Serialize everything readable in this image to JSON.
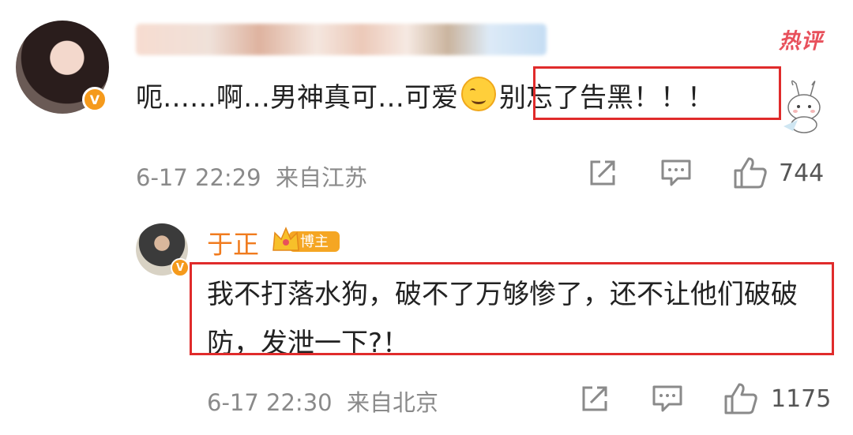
{
  "top_comment": {
    "hot_label": "热评",
    "verified_mark": "V",
    "text_before_emoji": "呃……啊…男神真可…可爱",
    "emoji": "smiling-face-emoji",
    "text_highlight": "别忘了告黑！！！",
    "date": "6-17 22:29",
    "location": "来自江苏",
    "likes": "744"
  },
  "reply": {
    "author": "于正",
    "badge": "博主",
    "verified_mark": "V",
    "text": "我不打落水狗，破不了万够惨了，还不让他们破破防，发泄一下?！",
    "date": "6-17 22:30",
    "location": "来自北京",
    "likes": "1175"
  },
  "icons": [
    "share-icon",
    "comment-icon",
    "like-icon"
  ],
  "colors": {
    "highlight_border": "#e02b2b",
    "name_orange": "#f07b1e",
    "hot_red": "#e8505b",
    "meta_gray": "#8a8a8a"
  }
}
